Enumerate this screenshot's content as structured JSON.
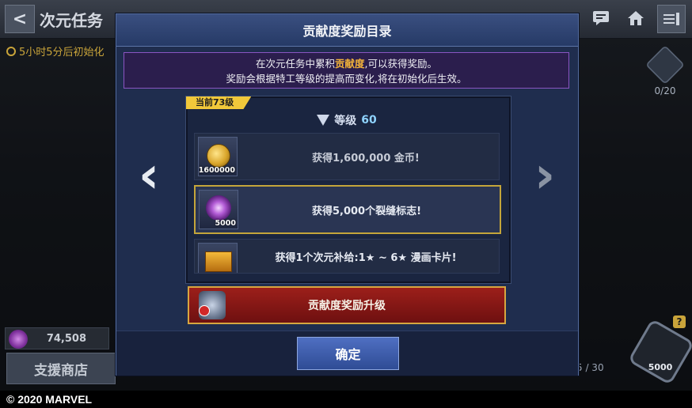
{
  "header": {
    "title": "次元任务"
  },
  "timer": {
    "text": "5小时5分后初始化"
  },
  "right_badge": {
    "count": "0/20"
  },
  "currency": {
    "amount": "74,508"
  },
  "support_shop": {
    "label": "支援商店"
  },
  "progress": {
    "label": "5 / 30"
  },
  "hex_reward": {
    "amount": "5000"
  },
  "modal": {
    "title": "贡献度奖励目录",
    "info": {
      "line1_pre": "在次元任务中累积",
      "line1_highlight": "贡献度",
      "line1_post": ",可以获得奖励。",
      "line2": "奖励会根据特工等级的提高而变化,将在初始化后生效。"
    },
    "current_tag": "当前73级",
    "level_label": "等级",
    "level_number": "60",
    "rewards": [
      {
        "icon": "gold-coin-icon",
        "qty": "1600000",
        "text": "获得1,600,000 金币!"
      },
      {
        "icon": "rift-mark-icon",
        "qty": "5000",
        "text": "获得5,000个裂缝标志!"
      },
      {
        "icon": "supply-chest-icon",
        "qty": "",
        "text": "获得1个次元补给:1★ ~ 6★ 漫画卡片!"
      }
    ],
    "upgrade_label": "贡献度奖励升级",
    "confirm_label": "确定",
    "arrow_left": "‹",
    "arrow_right": "›"
  },
  "footer": {
    "copyright": "© 2020 MARVEL"
  }
}
